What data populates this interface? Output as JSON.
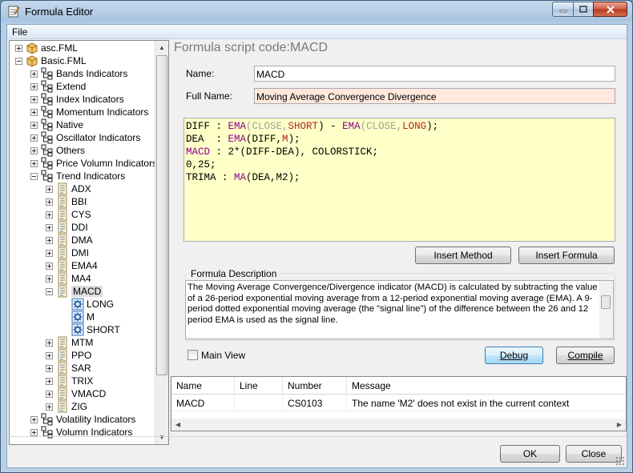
{
  "window": {
    "title": "Formula Editor"
  },
  "menu": {
    "file_label": "File"
  },
  "tree": {
    "roots": [
      {
        "label": "asc.FML",
        "expanded": false
      },
      {
        "label": "Basic.FML",
        "expanded": true
      }
    ],
    "categories": [
      "Bands Indicators",
      "Extend",
      "Index Indicators",
      "Momentum Indicators",
      "Native",
      "Oscillator Indicators",
      "Others",
      "Price Volumn Indicators",
      "Trend Indicators"
    ],
    "trend_items": [
      "ADX",
      "BBI",
      "CYS",
      "DDI",
      "DMA",
      "DMI",
      "EMA4",
      "MA4",
      "MACD"
    ],
    "macd_params": [
      "LONG",
      "M",
      "SHORT"
    ],
    "trend_items_after": [
      "MTM",
      "PPO",
      "SAR",
      "TRIX",
      "VMACD",
      "ZIG"
    ],
    "tail_categories": [
      "Volatility Indicators",
      "Volumn Indicators"
    ]
  },
  "editor": {
    "header": "Formula script code:MACD",
    "name_label": "Name:",
    "name_value": "MACD",
    "fullname_label": "Full Name:",
    "fullname_value": "Moving Average Convergence Divergence",
    "code_lines": [
      "DIFF : EMA(CLOSE,SHORT) - EMA(CLOSE,LONG);",
      "DEA  : EMA(DIFF,M);",
      "MACD : 2*(DIFF-DEA), COLORSTICK;",
      "0,25;",
      "TRIMA : MA(DEA,M2);"
    ],
    "insert_method_label": "Insert Method",
    "insert_formula_label": "Insert Formula",
    "description_caption": "Formula Description",
    "description_text": "The Moving Average Convergence/Divergence indicator (MACD) is calculated by subtracting the value of a 26-period exponential moving average from a 12-period exponential moving average (EMA). A 9-period dotted exponential moving average (the \"signal line\") of the difference between the 26 and 12 period EMA is used as the signal line.",
    "main_view_label": "Main View",
    "debug_label": "Debug",
    "compile_label": "Compile"
  },
  "errors": {
    "columns": [
      "Name",
      "Line",
      "Number",
      "Message"
    ],
    "rows": [
      {
        "name": "MACD",
        "line": "",
        "number": "CS0103",
        "message": "The name 'M2' does not exist in the current context"
      }
    ]
  },
  "footer": {
    "ok_label": "OK",
    "close_label": "Close"
  }
}
